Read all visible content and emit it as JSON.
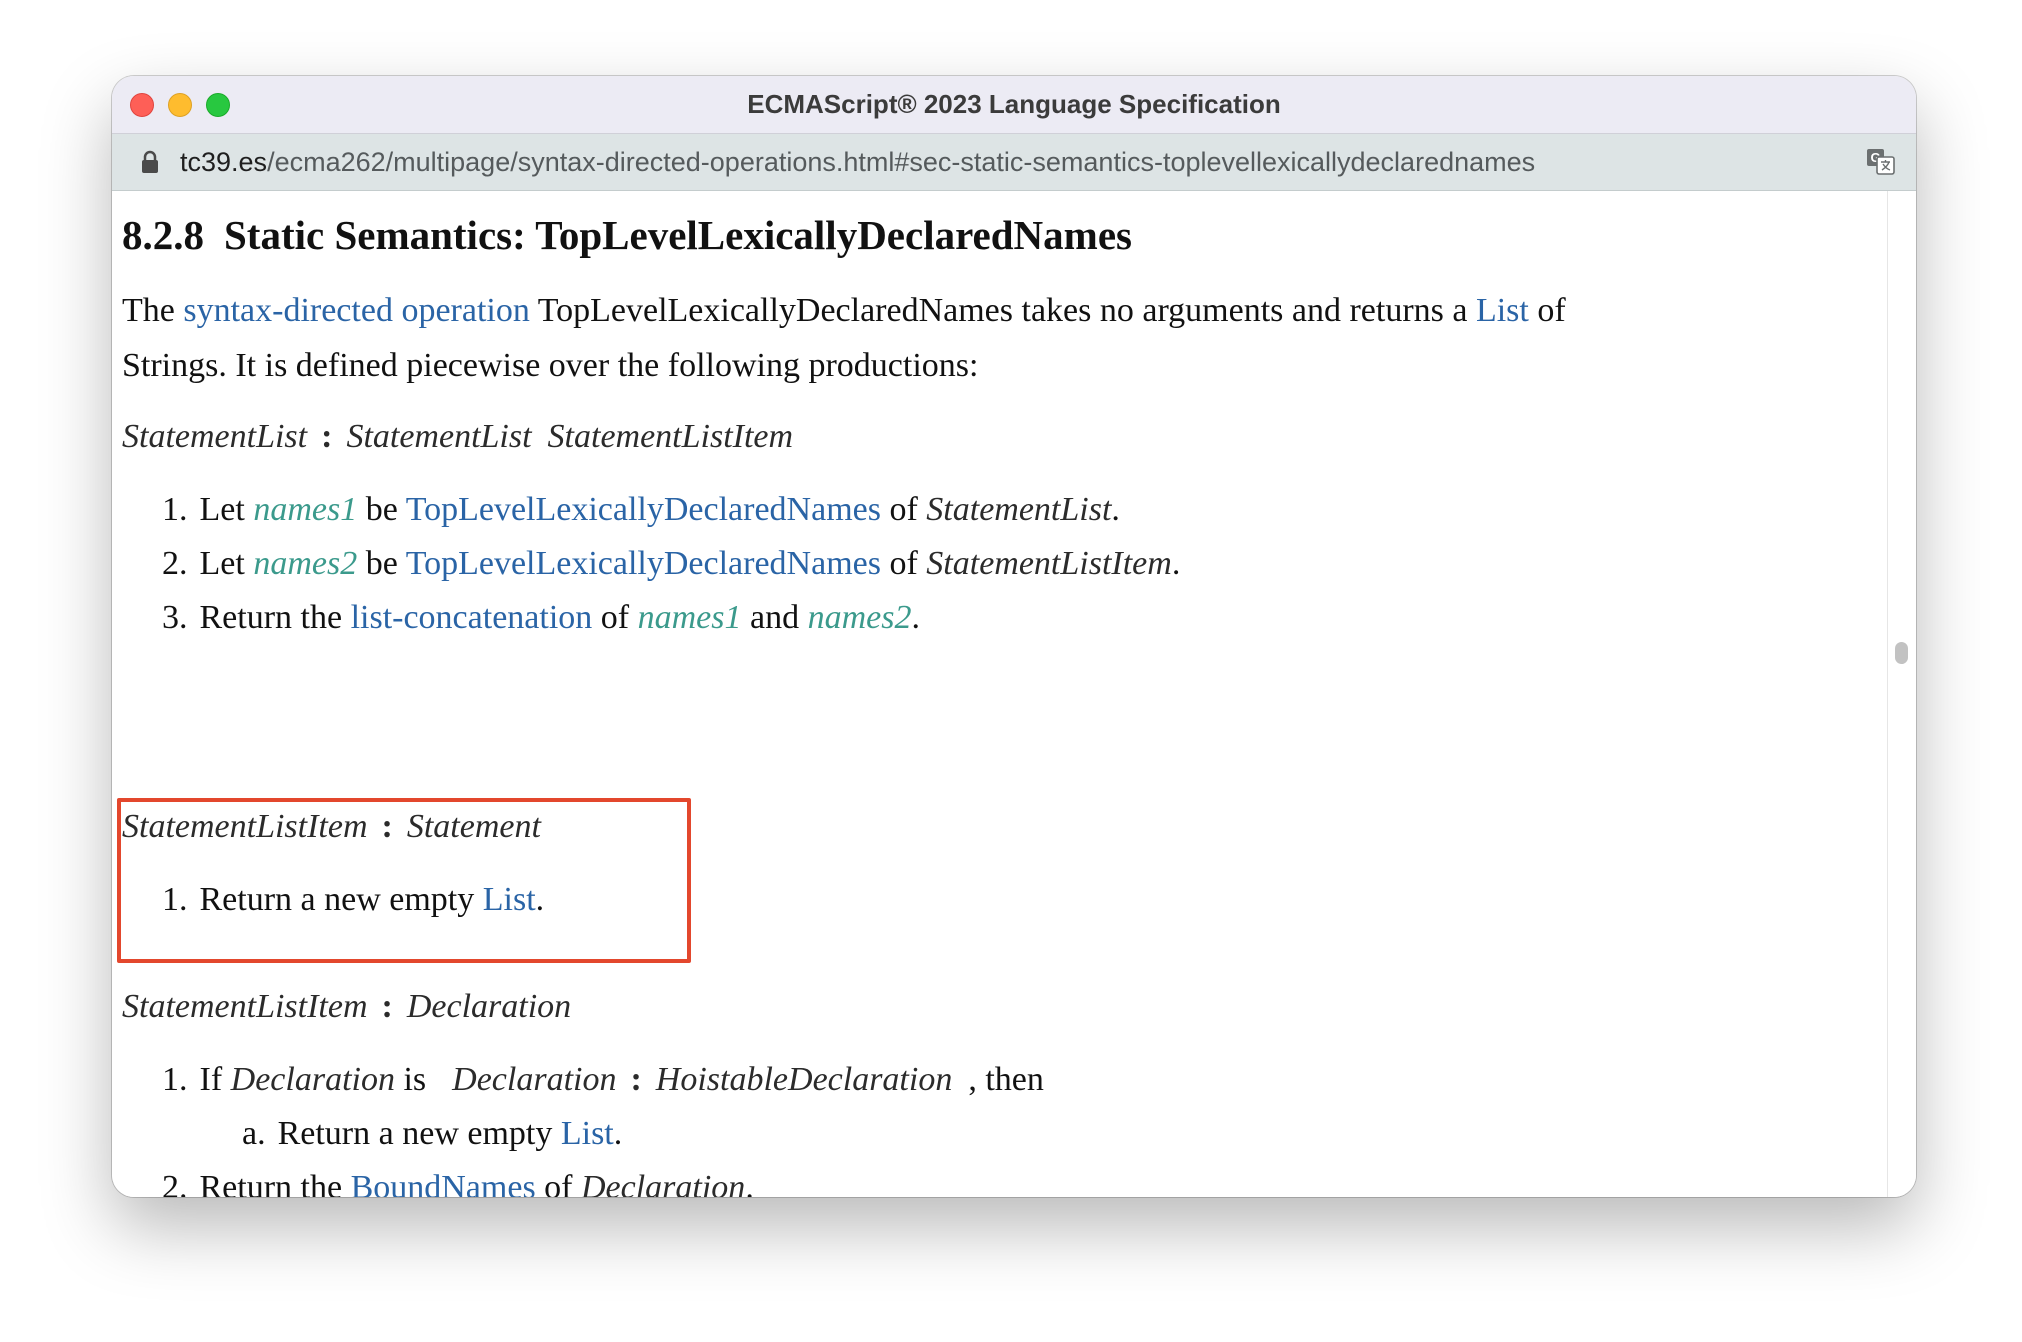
{
  "window": {
    "title": "ECMAScript® 2023 Language Specification"
  },
  "urlbar": {
    "domain": "tc39.es",
    "path": "/ecma262/multipage/syntax-directed-operations.html#sec-static-semantics-toplevellexicallydeclarednames"
  },
  "icons": {
    "lock": "lock-icon",
    "translate": "translate-icon"
  },
  "heading": {
    "number": "8.2.8",
    "title": "Static Semantics: TopLevelLexicallyDeclaredNames"
  },
  "intro": {
    "t1": "The ",
    "link1": "syntax-directed operation",
    "t2": " TopLevelLexicallyDeclaredNames takes no arguments and returns a ",
    "link2": "List",
    "t3": " of",
    "line2": "Strings. It is defined piecewise over the following productions:"
  },
  "prod1": {
    "lhs": "StatementList",
    "colon": ":",
    "rhs1": "StatementList",
    "rhs2": "StatementListItem"
  },
  "algo1": [
    {
      "num": "1.",
      "a": "Let ",
      "var1": "names1",
      "b": " be ",
      "link": "TopLevelLexicallyDeclaredNames",
      "c": " of ",
      "nt": "StatementList",
      "d": "."
    },
    {
      "num": "2.",
      "a": "Let ",
      "var1": "names2",
      "b": " be ",
      "link": "TopLevelLexicallyDeclaredNames",
      "c": " of ",
      "nt": "StatementListItem",
      "d": "."
    },
    {
      "num": "3.",
      "a": "Return the ",
      "link": "list-concatenation",
      "b": " of ",
      "var1": "names1",
      "c": " and ",
      "var2": "names2",
      "d": "."
    }
  ],
  "prod2": {
    "lhs": "StatementListItem",
    "colon": ":",
    "rhs1": "Statement"
  },
  "algo2": [
    {
      "num": "1.",
      "a": "Return a new empty ",
      "link": "List",
      "b": "."
    }
  ],
  "prod3": {
    "lhs": "StatementListItem",
    "colon": ":",
    "rhs1": "Declaration"
  },
  "algo3": {
    "step1": {
      "num": "1.",
      "a": "If ",
      "nt1": "Declaration",
      "b": " is",
      "inline_lhs": "Declaration",
      "colon": ":",
      "inline_rhs": "HoistableDeclaration",
      "c": ", then"
    },
    "step1a": {
      "num": "a.",
      "a": "Return a new empty ",
      "link": "List",
      "b": "."
    },
    "step2": {
      "num": "2.",
      "a": "Return the ",
      "link": "BoundNames",
      "b": " of ",
      "nt": "Declaration",
      "c": "."
    }
  },
  "colors": {
    "link": "#2a64a6",
    "variable": "#3b9a8c",
    "highlight_border": "#e3472d"
  }
}
